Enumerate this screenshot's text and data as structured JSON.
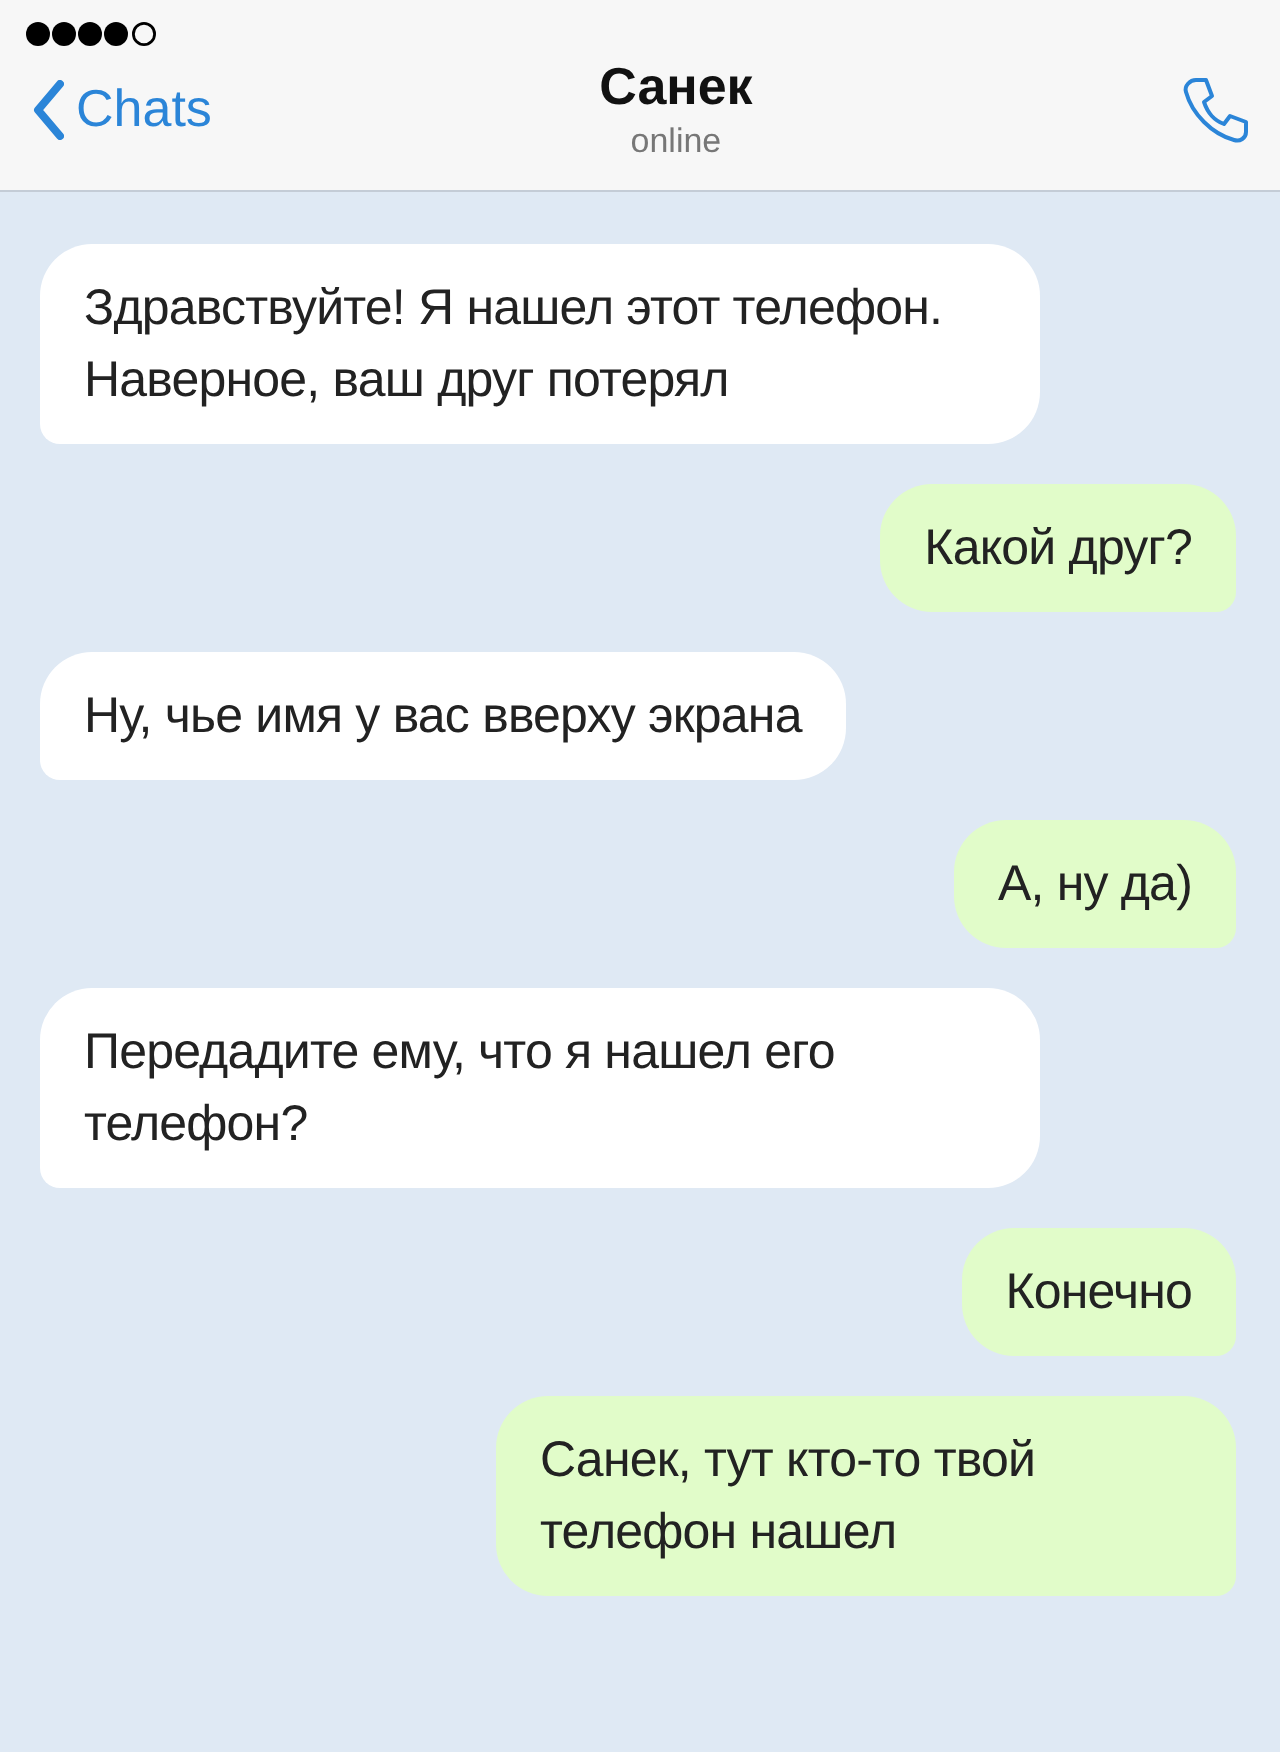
{
  "header": {
    "back_label": "Chats",
    "title": "Санек",
    "subtitle": "online"
  },
  "messages": [
    {
      "kind": "incoming",
      "text": "Здравствуйте! Я нашел этот телефон. Наверное, ваш друг потерял"
    },
    {
      "kind": "outgoing",
      "text": "Какой друг?"
    },
    {
      "kind": "incoming",
      "text": "Ну, чье имя у вас вверху экрана"
    },
    {
      "kind": "outgoing",
      "text": "А, ну да)"
    },
    {
      "kind": "incoming",
      "text": "Передадите ему, что я нашел его телефон?"
    },
    {
      "kind": "outgoing",
      "text": "Конечно"
    },
    {
      "kind": "outgoing",
      "text": "Санек, тут кто-то твой телефон нашел"
    }
  ]
}
